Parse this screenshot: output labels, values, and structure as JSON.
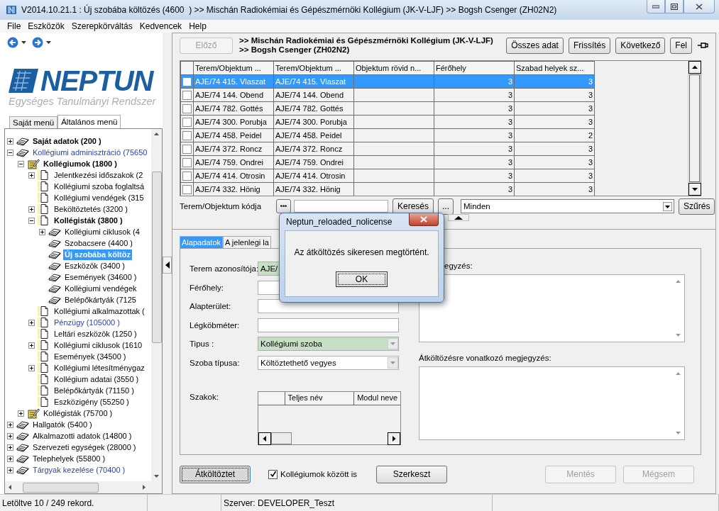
{
  "window": {
    "title": "V2014.10.21.1 : Új szobába költözés (4600  ) >> Mischán Radiokémiai és Gépészmérnöki Kollégium (JK-V-LJF) >> Bogsh Csenger (ZH02N2)"
  },
  "menu": [
    "File",
    "Eszközök",
    "Szerepkörváltás",
    "Kedvencek",
    "Help"
  ],
  "logo": {
    "name": "NEPTUN",
    "tagline": "Egységes Tanulmányi Rendszer"
  },
  "menu_tabs": [
    {
      "label": "Saját menü",
      "selected": false
    },
    {
      "label": "Általános menü",
      "selected": true
    }
  ],
  "tree": [
    {
      "label": "Saját adatok (200 )",
      "kind": "book",
      "bold": true,
      "link": false,
      "expanded": false,
      "selected": false
    },
    {
      "label": "Kollégiumi adminisztráció (75650",
      "kind": "book",
      "bold": false,
      "link": true,
      "expanded": true,
      "selected": false,
      "children": [
        {
          "label": "Kollégiumok (1800 )",
          "kind": "folder",
          "bold": true,
          "link": false,
          "expanded": true,
          "selected": false,
          "children": [
            {
              "label": "Jelentkezési időszakok (2",
              "kind": "page",
              "bold": false,
              "link": false,
              "expanded": false,
              "selected": false
            },
            {
              "label": "Kollégiumi szoba foglaltsá",
              "kind": "page",
              "bold": false,
              "link": false,
              "selected": false
            },
            {
              "label": "Kollégiumi vendégek (315",
              "kind": "page",
              "bold": false,
              "link": false,
              "selected": false
            },
            {
              "label": "Beköltöztetés (3200 )",
              "kind": "page",
              "bold": false,
              "link": false,
              "expanded": false,
              "selected": false
            },
            {
              "label": "Kollégisták (3800 )",
              "kind": "page",
              "bold": true,
              "link": false,
              "expanded": true,
              "selected": false,
              "children": [
                {
                  "label": "Kollégiumi ciklusok (4",
                  "kind": "book",
                  "bold": false,
                  "link": false,
                  "expanded": false,
                  "selected": false
                },
                {
                  "label": "Szobacsere (4400 )",
                  "kind": "book",
                  "bold": false,
                  "link": false,
                  "selected": false
                },
                {
                  "label": "Új szobába költöz",
                  "kind": "book",
                  "bold": true,
                  "link": false,
                  "selected": true
                },
                {
                  "label": "Eszközök (3400 )",
                  "kind": "book",
                  "bold": false,
                  "link": false,
                  "selected": false
                },
                {
                  "label": "Események (34600 )",
                  "kind": "book",
                  "bold": false,
                  "link": false,
                  "selected": false
                },
                {
                  "label": "Kollégiumi vendégek",
                  "kind": "book",
                  "bold": false,
                  "link": false,
                  "selected": false
                },
                {
                  "label": "Belépőkártyák (7125",
                  "kind": "book",
                  "bold": false,
                  "link": false,
                  "selected": false
                }
              ]
            },
            {
              "label": "Kollégiumi alkalmazottak (",
              "kind": "page",
              "bold": false,
              "link": false,
              "selected": false
            },
            {
              "label": "Pénzügy (105000 )",
              "kind": "page",
              "bold": false,
              "link": true,
              "expanded": false,
              "selected": false
            },
            {
              "label": "Leltári eszközök (1250 )",
              "kind": "page",
              "bold": false,
              "link": false,
              "selected": false
            },
            {
              "label": "Kollégiumi ciklusok (1610",
              "kind": "page",
              "bold": false,
              "link": false,
              "expanded": false,
              "selected": false
            },
            {
              "label": "Események (34500 )",
              "kind": "page",
              "bold": false,
              "link": false,
              "selected": false
            },
            {
              "label": "Kollégiumi létesítménygaz",
              "kind": "page",
              "bold": false,
              "link": false,
              "expanded": false,
              "selected": false
            },
            {
              "label": "Kollégium adatai (3550 )",
              "kind": "page",
              "bold": false,
              "link": false,
              "selected": false
            },
            {
              "label": "Belépőkártyák (71150 )",
              "kind": "page",
              "bold": false,
              "link": false,
              "selected": false
            },
            {
              "label": "Eszközigény (55250 )",
              "kind": "page",
              "bold": false,
              "link": false,
              "selected": false
            }
          ]
        },
        {
          "label": "Kollégisták (75700 )",
          "kind": "folder",
          "bold": false,
          "link": false,
          "expanded": false,
          "selected": false
        }
      ]
    },
    {
      "label": "Hallgatók (5400 )",
      "kind": "book",
      "bold": false,
      "link": false,
      "expanded": false,
      "selected": false
    },
    {
      "label": "Alkalmazotti adatok (14800 )",
      "kind": "book",
      "bold": false,
      "link": false,
      "expanded": false,
      "selected": false
    },
    {
      "label": "Szervezeti egységek (28000 )",
      "kind": "book",
      "bold": false,
      "link": false,
      "expanded": false,
      "selected": false
    },
    {
      "label": "Telephelyek (55800 )",
      "kind": "book",
      "bold": false,
      "link": false,
      "expanded": false,
      "selected": false
    },
    {
      "label": "Tárgyak kezelése (70400 )",
      "kind": "book",
      "bold": false,
      "link": true,
      "expanded": false,
      "selected": false
    }
  ],
  "header": {
    "prev_button": {
      "label": "Előző",
      "disabled": true
    },
    "breadcrumb": [
      ">> Mischán Radiokémiai és Gépészmérnöki Kollégium (JK-V-LJF)",
      ">> Bogsh Csenger (ZH02N2)"
    ],
    "buttons": [
      "Összes adat",
      "Frissítés",
      "Következő",
      "Fel"
    ]
  },
  "table": {
    "columns": [
      "Terem/Objektum ...",
      "Terem/Objektum ...",
      "Objektum rövid n...",
      "Férőhely",
      "Szabad helyek sz..."
    ],
    "rows": [
      {
        "cells": [
          "AJE/74 415. Vlaszat",
          "AJE/74 415. Vlaszat",
          "",
          "3",
          "3"
        ],
        "checked": false,
        "selected": true
      },
      {
        "cells": [
          "AJE/74 144. Obend",
          "AJE/74 144. Obend",
          "",
          "3",
          "3"
        ],
        "checked": false,
        "selected": false
      },
      {
        "cells": [
          "AJE/74 782. Gottés",
          "AJE/74 782. Gottés",
          "",
          "3",
          "3"
        ],
        "checked": false,
        "selected": false
      },
      {
        "cells": [
          "AJE/74 300. Porubja",
          "AJE/74 300. Porubja",
          "",
          "3",
          "3"
        ],
        "checked": false,
        "selected": false
      },
      {
        "cells": [
          "AJE/74 458. Peidel",
          "AJE/74 458. Peidel",
          "",
          "3",
          "2"
        ],
        "checked": false,
        "selected": false
      },
      {
        "cells": [
          "AJE/74 372. Roncz",
          "AJE/74 372. Roncz",
          "",
          "3",
          "3"
        ],
        "checked": false,
        "selected": false
      },
      {
        "cells": [
          "AJE/74 759. Ondrei",
          "AJE/74 759. Ondrei",
          "",
          "3",
          "3"
        ],
        "checked": false,
        "selected": false
      },
      {
        "cells": [
          "AJE/74 414. Otrosin",
          "AJE/74 414. Otrosin",
          "",
          "3",
          "3"
        ],
        "checked": false,
        "selected": false
      },
      {
        "cells": [
          "AJE/74 332. Hönig",
          "AJE/74 332. Hönig",
          "",
          "3",
          "3"
        ],
        "checked": false,
        "selected": false
      }
    ]
  },
  "filter": {
    "label": "Terem/Objektum kódja",
    "dots_button": "•••",
    "search_button": "Keresés",
    "more_button": "...",
    "select": "Minden",
    "filter_button": "Szűrés"
  },
  "form": {
    "tabs": [
      {
        "label": "Alapadatok",
        "selected": true
      },
      {
        "label": "A jelenlegi la",
        "selected": false
      }
    ],
    "fields": [
      {
        "label": "Terem azonosítója:",
        "kind": "text",
        "value": "AJE/",
        "locked": true
      },
      {
        "label": "Férőhely:",
        "kind": "text",
        "locked": false
      },
      {
        "label": "Alapterület:",
        "kind": "text",
        "locked": false
      },
      {
        "label": "Légköbméter:",
        "kind": "text",
        "locked": false
      },
      {
        "label": "Tipus :",
        "kind": "select",
        "value": "Kollégiumi szoba",
        "locked": true
      },
      {
        "label": "Szoba típusa:",
        "kind": "select",
        "value": "Költöztethető vegyes",
        "locked": false
      }
    ],
    "majors": {
      "label": "Szakok:",
      "columns": [
        "Teljes név",
        "Modul neve"
      ]
    },
    "notes": [
      "egyzés:",
      "Átköltözésre vonatkozó megjegyzés:"
    ]
  },
  "actions": {
    "left": [
      {
        "label": "Átköltöztet",
        "focused": true,
        "disabled": false
      }
    ],
    "checkbox": {
      "label": "Kollégiumok között is",
      "checked": true
    },
    "middle": [
      {
        "label": "Szerkeszt",
        "focused": false,
        "disabled": false
      }
    ],
    "right": [
      {
        "label": "Mentés",
        "focused": false,
        "disabled": true
      },
      {
        "label": "Mégsem",
        "focused": false,
        "disabled": true
      }
    ]
  },
  "status_bar": [
    "Letöltve 10 / 249 rekord.",
    "Szerver: DEVELOPER_Teszt"
  ],
  "dialog": {
    "title": "Neptun_reloaded_nolicense",
    "message": "Az átköltözés sikeresen megtörtént.",
    "button": "OK"
  }
}
